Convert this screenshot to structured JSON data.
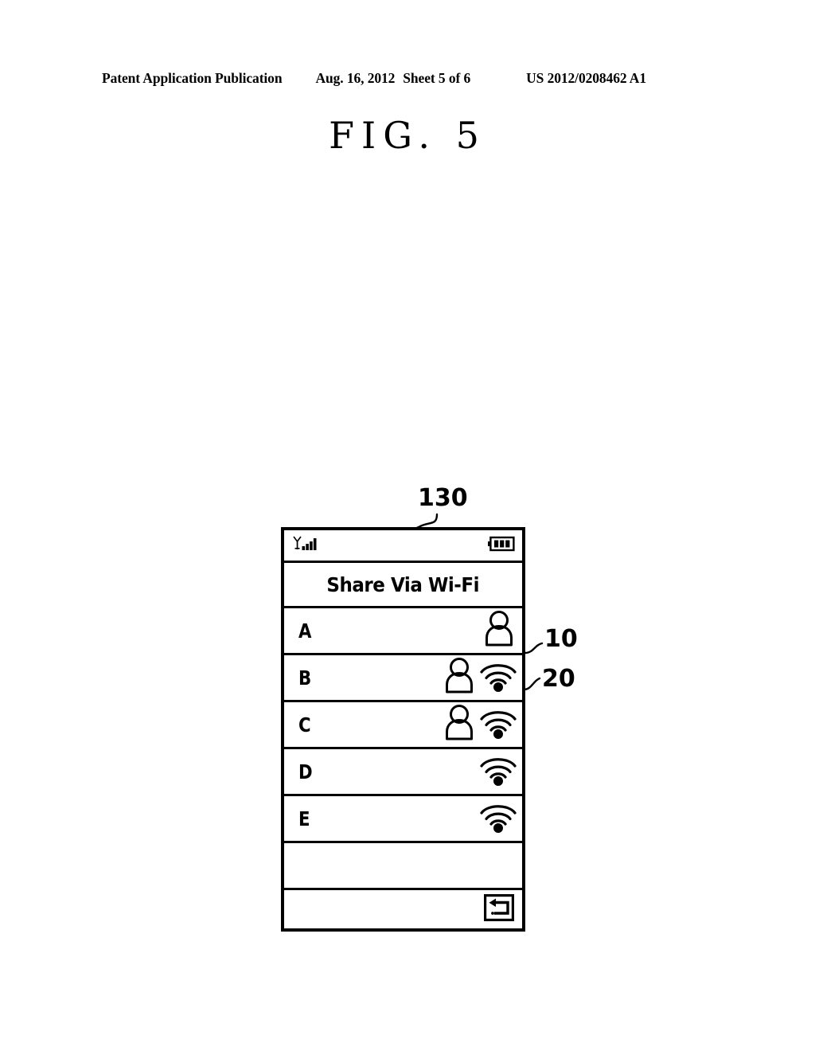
{
  "page_header": {
    "publication": "Patent Application Publication",
    "date": "Aug. 16, 2012",
    "sheet": "Sheet 5 of 6",
    "patent_number": "US 2012/0208462 A1"
  },
  "figure": {
    "title": "FIG. 5"
  },
  "reference_numerals": {
    "device": "130",
    "person_icon": "10",
    "wifi_icon": "20"
  },
  "device": {
    "status_bar": {
      "signal_icon": "signal-bars-icon",
      "signal_bars": 4,
      "battery_icon": "battery-icon",
      "battery_segments": 3
    },
    "title_bar": {
      "title": "Share Via Wi-Fi"
    },
    "list": {
      "rows": [
        {
          "label": "A",
          "person": true,
          "wifi": false
        },
        {
          "label": "B",
          "person": true,
          "wifi": true
        },
        {
          "label": "C",
          "person": true,
          "wifi": true
        },
        {
          "label": "D",
          "person": false,
          "wifi": true
        },
        {
          "label": "E",
          "person": false,
          "wifi": true
        }
      ]
    },
    "bottom_bar": {
      "back_icon": "back-arrow-icon"
    }
  },
  "colors": {
    "ink": "#000000",
    "paper": "#ffffff"
  }
}
